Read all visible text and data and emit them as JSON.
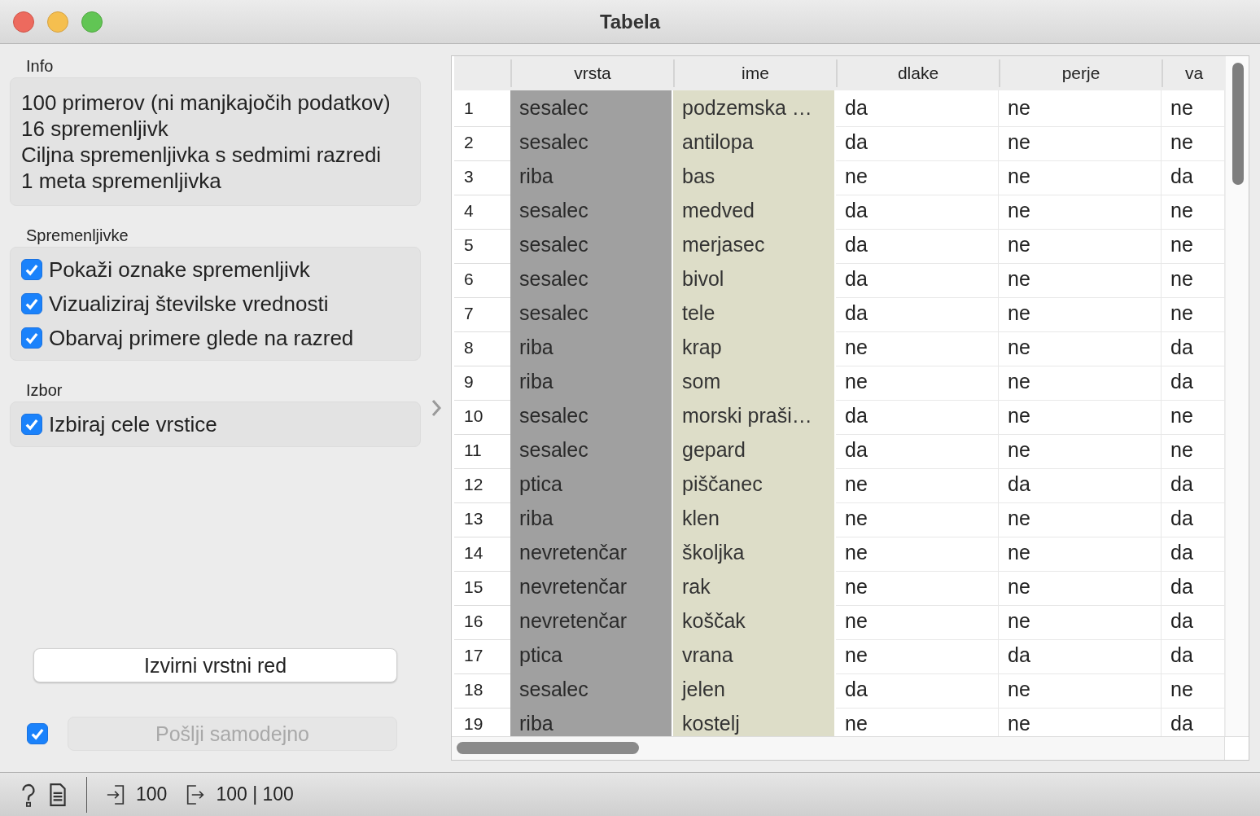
{
  "window": {
    "title": "Tabela"
  },
  "info": {
    "label": "Info",
    "lines": [
      "100 primerov (ni manjkajočih podatkov)",
      "16  spremenljivk",
      "Ciljna spremenljivka s sedmimi razredi",
      "1 meta spremenljivka"
    ]
  },
  "variables": {
    "label": "Spremenljivke",
    "options": [
      {
        "label": "Pokaži oznake spremenljivk",
        "checked": true
      },
      {
        "label": "Vizualiziraj številske vrednosti",
        "checked": true
      },
      {
        "label": "Obarvaj primere glede na razred",
        "checked": true
      }
    ]
  },
  "selection": {
    "label": "Izbor",
    "options": [
      {
        "label": "Izbiraj cele vrstice",
        "checked": true
      }
    ]
  },
  "restore_button": {
    "label": "Izvirni vrstni red"
  },
  "send": {
    "checked": true,
    "label": "Pošlji samodejno",
    "disabled": true
  },
  "table": {
    "columns": [
      {
        "label": "vrsta",
        "kind": "class"
      },
      {
        "label": "ime",
        "kind": "meta"
      },
      {
        "label": "dlake",
        "kind": "attribute"
      },
      {
        "label": "perje",
        "kind": "attribute"
      },
      {
        "label": "va",
        "kind": "attribute"
      }
    ],
    "rows": [
      {
        "number": "1",
        "cells": [
          "sesalec",
          "podzemska …",
          "da",
          "ne",
          "ne"
        ]
      },
      {
        "number": "2",
        "cells": [
          "sesalec",
          "antilopa",
          "da",
          "ne",
          "ne"
        ]
      },
      {
        "number": "3",
        "cells": [
          "riba",
          "bas",
          "ne",
          "ne",
          "da"
        ]
      },
      {
        "number": "4",
        "cells": [
          "sesalec",
          "medved",
          "da",
          "ne",
          "ne"
        ]
      },
      {
        "number": "5",
        "cells": [
          "sesalec",
          "merjasec",
          "da",
          "ne",
          "ne"
        ]
      },
      {
        "number": "6",
        "cells": [
          "sesalec",
          "bivol",
          "da",
          "ne",
          "ne"
        ]
      },
      {
        "number": "7",
        "cells": [
          "sesalec",
          "tele",
          "da",
          "ne",
          "ne"
        ]
      },
      {
        "number": "8",
        "cells": [
          "riba",
          "krap",
          "ne",
          "ne",
          "da"
        ]
      },
      {
        "number": "9",
        "cells": [
          "riba",
          "som",
          "ne",
          "ne",
          "da"
        ]
      },
      {
        "number": "10",
        "cells": [
          "sesalec",
          "morski praši…",
          "da",
          "ne",
          "ne"
        ]
      },
      {
        "number": "11",
        "cells": [
          "sesalec",
          "gepard",
          "da",
          "ne",
          "ne"
        ]
      },
      {
        "number": "12",
        "cells": [
          "ptica",
          "piščanec",
          "ne",
          "da",
          "da"
        ]
      },
      {
        "number": "13",
        "cells": [
          "riba",
          "klen",
          "ne",
          "ne",
          "da"
        ]
      },
      {
        "number": "14",
        "cells": [
          "nevretenčar",
          "školjka",
          "ne",
          "ne",
          "da"
        ]
      },
      {
        "number": "15",
        "cells": [
          "nevretenčar",
          "rak",
          "ne",
          "ne",
          "da"
        ]
      },
      {
        "number": "16",
        "cells": [
          "nevretenčar",
          "koščak",
          "ne",
          "ne",
          "da"
        ]
      },
      {
        "number": "17",
        "cells": [
          "ptica",
          "vrana",
          "ne",
          "da",
          "da"
        ]
      },
      {
        "number": "18",
        "cells": [
          "sesalec",
          "jelen",
          "da",
          "ne",
          "ne"
        ]
      },
      {
        "number": "19",
        "cells": [
          "riba",
          "kostelj",
          "ne",
          "ne",
          "da"
        ]
      }
    ]
  },
  "status_bar": {
    "input_count": "100",
    "output_count": "100 | 100"
  }
}
